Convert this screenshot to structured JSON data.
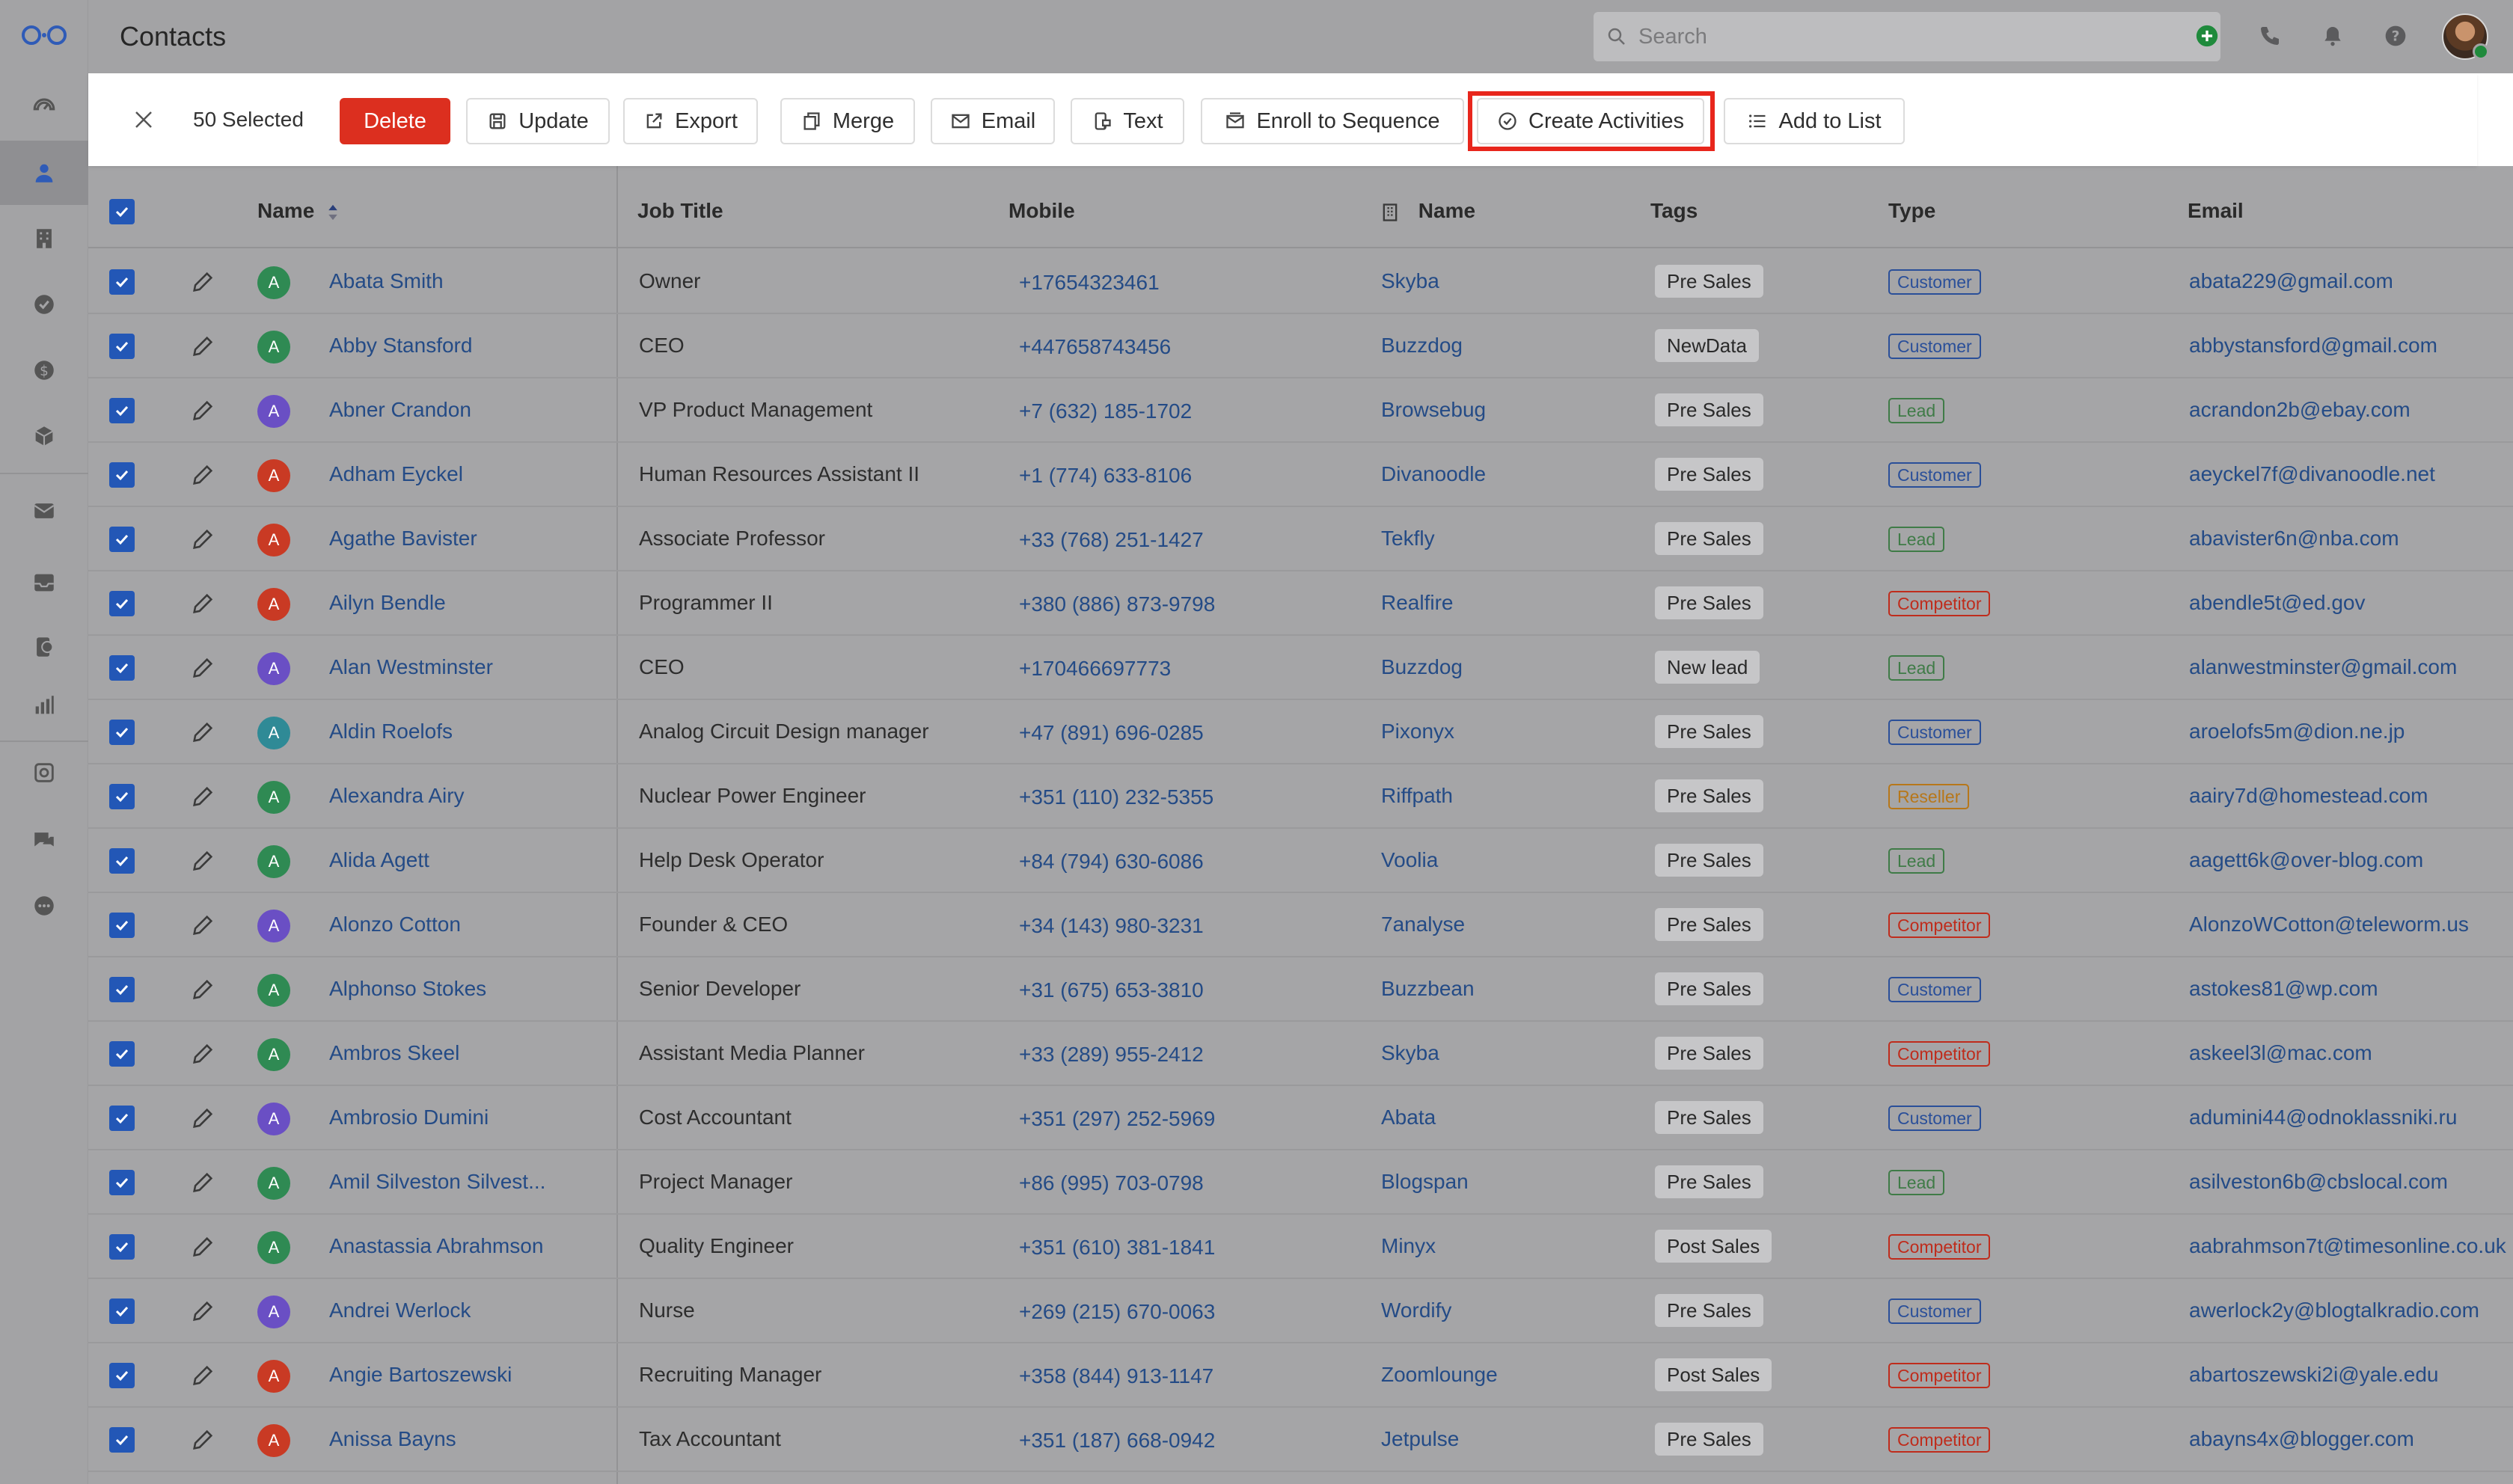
{
  "app": {
    "title": "Contacts"
  },
  "search": {
    "placeholder": "Search"
  },
  "sidebar": {
    "items": [
      {
        "icon": "dashboard-icon"
      },
      {
        "icon": "person-icon",
        "active": true
      },
      {
        "icon": "building-icon"
      },
      {
        "icon": "check-circle-icon"
      },
      {
        "icon": "dollar-icon"
      },
      {
        "icon": "cube-icon"
      },
      {
        "icon": "mail-icon"
      },
      {
        "icon": "inbox-icon"
      },
      {
        "icon": "phone-document-icon"
      },
      {
        "icon": "bar-chart-icon"
      },
      {
        "icon": "automation-icon"
      },
      {
        "icon": "chat-icon"
      },
      {
        "icon": "more-icon"
      }
    ]
  },
  "header_icons": [
    "add-icon",
    "phone-icon",
    "bell-icon",
    "help-icon"
  ],
  "actionbar": {
    "selected": "50 Selected",
    "delete": "Delete",
    "update": "Update",
    "export": "Export",
    "merge": "Merge",
    "email": "Email",
    "text": "Text",
    "enroll": "Enroll to Sequence",
    "create_activities": "Create Activities",
    "add_to_list": "Add to List"
  },
  "columns": {
    "name": "Name",
    "job_title": "Job Title",
    "mobile": "Mobile",
    "company_name": "Name",
    "tags": "Tags",
    "type": "Type",
    "email": "Email"
  },
  "colors": {
    "avatar_green": "#2f8a53",
    "avatar_purple": "#6a4fc4",
    "avatar_red": "#c93a24",
    "avatar_teal": "#2f8a96",
    "type_customer": "#2a4f99",
    "type_lead": "#3f7b47",
    "type_competitor": "#bf2c1c",
    "type_reseller": "#b7771a",
    "highlight": "#e8261c"
  },
  "rows": [
    {
      "initial": "A",
      "avatar": "green",
      "name": "Abata Smith",
      "job": "Owner",
      "mobile": "+17654323461",
      "company": "Skyba",
      "tag": "Pre Sales",
      "type": "Customer",
      "email": "abata229@gmail.com"
    },
    {
      "initial": "A",
      "avatar": "green",
      "name": "Abby Stansford",
      "job": "CEO",
      "mobile": "+447658743456",
      "company": "Buzzdog",
      "tag": "NewData",
      "type": "Customer",
      "email": "abbystansford@gmail.com"
    },
    {
      "initial": "A",
      "avatar": "purple",
      "name": "Abner Crandon",
      "job": "VP Product Management",
      "mobile": "+7 (632) 185-1702",
      "company": "Browsebug",
      "tag": "Pre Sales",
      "type": "Lead",
      "email": "acrandon2b@ebay.com"
    },
    {
      "initial": "A",
      "avatar": "red",
      "name": "Adham Eyckel",
      "job": "Human Resources Assistant II",
      "mobile": "+1 (774) 633-8106",
      "company": "Divanoodle",
      "tag": "Pre Sales",
      "type": "Customer",
      "email": "aeyckel7f@divanoodle.net"
    },
    {
      "initial": "A",
      "avatar": "red",
      "name": "Agathe Bavister",
      "job": "Associate Professor",
      "mobile": "+33 (768) 251-1427",
      "company": "Tekfly",
      "tag": "Pre Sales",
      "type": "Lead",
      "email": "abavister6n@nba.com"
    },
    {
      "initial": "A",
      "avatar": "red",
      "name": "Ailyn Bendle",
      "job": "Programmer II",
      "mobile": "+380 (886) 873-9798",
      "company": "Realfire",
      "tag": "Pre Sales",
      "type": "Competitor",
      "email": "abendle5t@ed.gov"
    },
    {
      "initial": "A",
      "avatar": "purple",
      "name": "Alan Westminster",
      "job": "CEO",
      "mobile": "+170466697773",
      "company": "Buzzdog",
      "tag": "New lead",
      "type": "Lead",
      "email": "alanwestminster@gmail.com"
    },
    {
      "initial": "A",
      "avatar": "teal",
      "name": "Aldin Roelofs",
      "job": "Analog Circuit Design manager",
      "mobile": "+47 (891) 696-0285",
      "company": "Pixonyx",
      "tag": "Pre Sales",
      "type": "Customer",
      "email": "aroelofs5m@dion.ne.jp"
    },
    {
      "initial": "A",
      "avatar": "green",
      "name": "Alexandra Airy",
      "job": "Nuclear Power Engineer",
      "mobile": "+351 (110) 232-5355",
      "company": "Riffpath",
      "tag": "Pre Sales",
      "type": "Reseller",
      "email": "aairy7d@homestead.com"
    },
    {
      "initial": "A",
      "avatar": "green",
      "name": "Alida Agett",
      "job": "Help Desk Operator",
      "mobile": "+84 (794) 630-6086",
      "company": "Voolia",
      "tag": "Pre Sales",
      "type": "Lead",
      "email": "aagett6k@over-blog.com"
    },
    {
      "initial": "A",
      "avatar": "purple",
      "name": "Alonzo Cotton",
      "job": "Founder & CEO",
      "mobile": "+34 (143) 980-3231",
      "company": "7analyse",
      "tag": "Pre Sales",
      "type": "Competitor",
      "email": "AlonzoWCotton@teleworm.us"
    },
    {
      "initial": "A",
      "avatar": "green",
      "name": "Alphonso Stokes",
      "job": "Senior Developer",
      "mobile": "+31 (675) 653-3810",
      "company": "Buzzbean",
      "tag": "Pre Sales",
      "type": "Customer",
      "email": "astokes81@wp.com"
    },
    {
      "initial": "A",
      "avatar": "green",
      "name": "Ambros Skeel",
      "job": "Assistant Media Planner",
      "mobile": "+33 (289) 955-2412",
      "company": "Skyba",
      "tag": "Pre Sales",
      "type": "Competitor",
      "email": "askeel3l@mac.com"
    },
    {
      "initial": "A",
      "avatar": "purple",
      "name": "Ambrosio Dumini",
      "job": "Cost Accountant",
      "mobile": "+351 (297) 252-5969",
      "company": "Abata",
      "tag": "Pre Sales",
      "type": "Customer",
      "email": "adumini44@odnoklassniki.ru"
    },
    {
      "initial": "A",
      "avatar": "green",
      "name": "Amil Silveston Silvest...",
      "job": "Project Manager",
      "mobile": "+86 (995) 703-0798",
      "company": "Blogspan",
      "tag": "Pre Sales",
      "type": "Lead",
      "email": "asilveston6b@cbslocal.com"
    },
    {
      "initial": "A",
      "avatar": "green",
      "name": "Anastassia Abrahmson",
      "job": "Quality Engineer",
      "mobile": "+351 (610) 381-1841",
      "company": "Minyx",
      "tag": "Post Sales",
      "type": "Competitor",
      "email": "aabrahmson7t@timesonline.co.uk"
    },
    {
      "initial": "A",
      "avatar": "purple",
      "name": "Andrei Werlock",
      "job": "Nurse",
      "mobile": "+269 (215) 670-0063",
      "company": "Wordify",
      "tag": "Pre Sales",
      "type": "Customer",
      "email": "awerlock2y@blogtalkradio.com"
    },
    {
      "initial": "A",
      "avatar": "red",
      "name": "Angie Bartoszewski",
      "job": "Recruiting Manager",
      "mobile": "+358 (844) 913-1147",
      "company": "Zoomlounge",
      "tag": "Post Sales",
      "type": "Competitor",
      "email": "abartoszewski2i@yale.edu"
    },
    {
      "initial": "A",
      "avatar": "red",
      "name": "Anissa Bayns",
      "job": "Tax Accountant",
      "mobile": "+351 (187) 668-0942",
      "company": "Jetpulse",
      "tag": "Pre Sales",
      "type": "Competitor",
      "email": "abayns4x@blogger.com"
    }
  ]
}
